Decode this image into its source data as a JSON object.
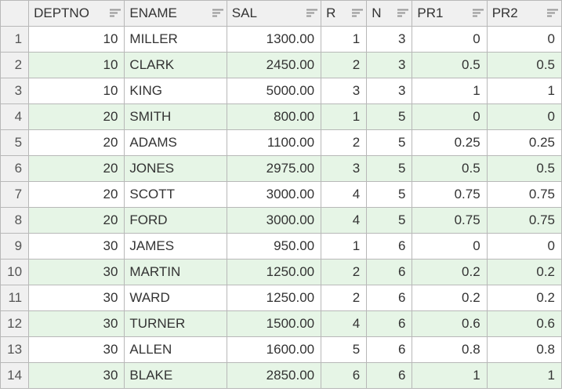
{
  "chart_data": {
    "type": "table",
    "columns": [
      "DEPTNO",
      "ENAME",
      "SAL",
      "R",
      "N",
      "PR1",
      "PR2"
    ],
    "rows": [
      [
        10,
        "MILLER",
        "1300.00",
        1,
        3,
        "0",
        "0"
      ],
      [
        10,
        "CLARK",
        "2450.00",
        2,
        3,
        "0.5",
        "0.5"
      ],
      [
        10,
        "KING",
        "5000.00",
        3,
        3,
        "1",
        "1"
      ],
      [
        20,
        "SMITH",
        "800.00",
        1,
        5,
        "0",
        "0"
      ],
      [
        20,
        "ADAMS",
        "1100.00",
        2,
        5,
        "0.25",
        "0.25"
      ],
      [
        20,
        "JONES",
        "2975.00",
        3,
        5,
        "0.5",
        "0.5"
      ],
      [
        20,
        "SCOTT",
        "3000.00",
        4,
        5,
        "0.75",
        "0.75"
      ],
      [
        20,
        "FORD",
        "3000.00",
        4,
        5,
        "0.75",
        "0.75"
      ],
      [
        30,
        "JAMES",
        "950.00",
        1,
        6,
        "0",
        "0"
      ],
      [
        30,
        "MARTIN",
        "1250.00",
        2,
        6,
        "0.2",
        "0.2"
      ],
      [
        30,
        "WARD",
        "1250.00",
        2,
        6,
        "0.2",
        "0.2"
      ],
      [
        30,
        "TURNER",
        "1500.00",
        4,
        6,
        "0.6",
        "0.6"
      ],
      [
        30,
        "ALLEN",
        "1600.00",
        5,
        6,
        "0.8",
        "0.8"
      ],
      [
        30,
        "BLAKE",
        "2850.00",
        6,
        6,
        "1",
        "1"
      ]
    ]
  },
  "columns": [
    {
      "key": "deptno",
      "label": "DEPTNO",
      "align": "num"
    },
    {
      "key": "ename",
      "label": "ENAME",
      "align": "txt"
    },
    {
      "key": "sal",
      "label": "SAL",
      "align": "num"
    },
    {
      "key": "r",
      "label": "R",
      "align": "num"
    },
    {
      "key": "n",
      "label": "N",
      "align": "num"
    },
    {
      "key": "pr1",
      "label": "PR1",
      "align": "num"
    },
    {
      "key": "pr2",
      "label": "PR2",
      "align": "num"
    }
  ],
  "rows": [
    {
      "n": "1",
      "deptno": "10",
      "ename": "MILLER",
      "sal": "1300.00",
      "r": "1",
      "ncol": "3",
      "pr1": "0",
      "pr2": "0"
    },
    {
      "n": "2",
      "deptno": "10",
      "ename": "CLARK",
      "sal": "2450.00",
      "r": "2",
      "ncol": "3",
      "pr1": "0.5",
      "pr2": "0.5"
    },
    {
      "n": "3",
      "deptno": "10",
      "ename": "KING",
      "sal": "5000.00",
      "r": "3",
      "ncol": "3",
      "pr1": "1",
      "pr2": "1"
    },
    {
      "n": "4",
      "deptno": "20",
      "ename": "SMITH",
      "sal": "800.00",
      "r": "1",
      "ncol": "5",
      "pr1": "0",
      "pr2": "0"
    },
    {
      "n": "5",
      "deptno": "20",
      "ename": "ADAMS",
      "sal": "1100.00",
      "r": "2",
      "ncol": "5",
      "pr1": "0.25",
      "pr2": "0.25"
    },
    {
      "n": "6",
      "deptno": "20",
      "ename": "JONES",
      "sal": "2975.00",
      "r": "3",
      "ncol": "5",
      "pr1": "0.5",
      "pr2": "0.5"
    },
    {
      "n": "7",
      "deptno": "20",
      "ename": "SCOTT",
      "sal": "3000.00",
      "r": "4",
      "ncol": "5",
      "pr1": "0.75",
      "pr2": "0.75"
    },
    {
      "n": "8",
      "deptno": "20",
      "ename": "FORD",
      "sal": "3000.00",
      "r": "4",
      "ncol": "5",
      "pr1": "0.75",
      "pr2": "0.75"
    },
    {
      "n": "9",
      "deptno": "30",
      "ename": "JAMES",
      "sal": "950.00",
      "r": "1",
      "ncol": "6",
      "pr1": "0",
      "pr2": "0"
    },
    {
      "n": "10",
      "deptno": "30",
      "ename": "MARTIN",
      "sal": "1250.00",
      "r": "2",
      "ncol": "6",
      "pr1": "0.2",
      "pr2": "0.2"
    },
    {
      "n": "11",
      "deptno": "30",
      "ename": "WARD",
      "sal": "1250.00",
      "r": "2",
      "ncol": "6",
      "pr1": "0.2",
      "pr2": "0.2"
    },
    {
      "n": "12",
      "deptno": "30",
      "ename": "TURNER",
      "sal": "1500.00",
      "r": "4",
      "ncol": "6",
      "pr1": "0.6",
      "pr2": "0.6"
    },
    {
      "n": "13",
      "deptno": "30",
      "ename": "ALLEN",
      "sal": "1600.00",
      "r": "5",
      "ncol": "6",
      "pr1": "0.8",
      "pr2": "0.8"
    },
    {
      "n": "14",
      "deptno": "30",
      "ename": "BLAKE",
      "sal": "2850.00",
      "r": "6",
      "ncol": "6",
      "pr1": "1",
      "pr2": "1"
    }
  ]
}
